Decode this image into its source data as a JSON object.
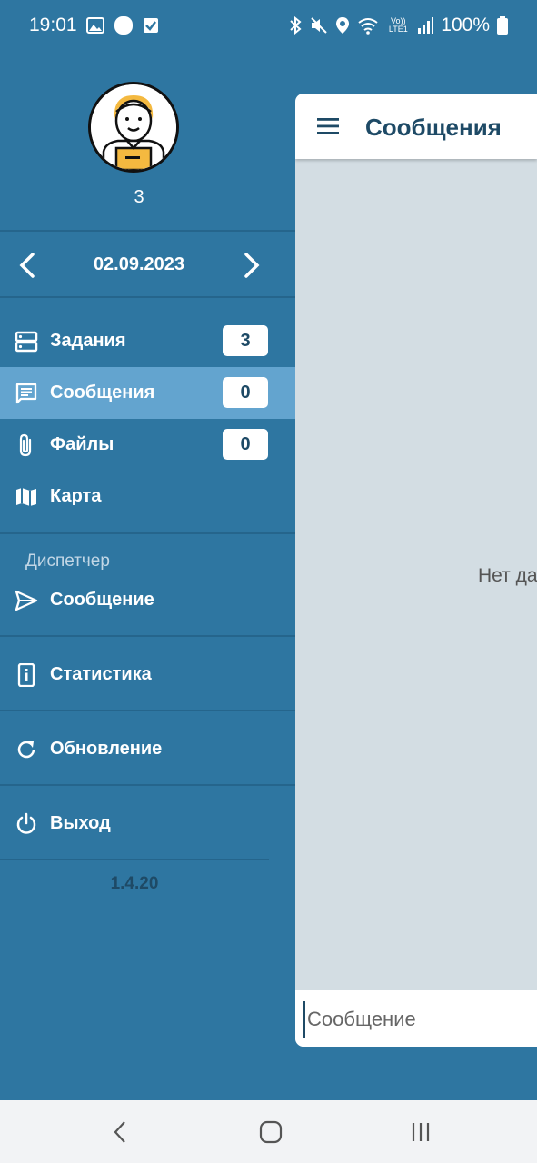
{
  "status_bar": {
    "time": "19:01",
    "battery": "100%",
    "left_icons": [
      "gallery-icon",
      "circle-notification-icon",
      "checkbox-notification-icon"
    ],
    "right_icons": [
      "bluetooth-icon",
      "mute-icon",
      "location-icon",
      "wifi-icon",
      "volte-icon",
      "signal-icon",
      "battery-icon"
    ],
    "volte_label": "Vo)) LTE1"
  },
  "drawer": {
    "user_name": "3",
    "date": "02.09.2023",
    "items": [
      {
        "label": "Задания",
        "badge": "3",
        "icon": "tasks-icon"
      },
      {
        "label": "Сообщения",
        "badge": "0",
        "icon": "messages-icon",
        "active": true
      },
      {
        "label": "Файлы",
        "badge": "0",
        "icon": "paperclip-icon"
      },
      {
        "label": "Карта",
        "icon": "map-icon"
      }
    ],
    "section_header": "Диспетчер",
    "dispatcher_items": [
      {
        "label": "Сообщение",
        "icon": "send-icon"
      }
    ],
    "extra_items": [
      {
        "label": "Статистика",
        "icon": "statistics-icon"
      },
      {
        "label": "Обновление",
        "icon": "refresh-icon"
      },
      {
        "label": "Выход",
        "icon": "power-icon"
      }
    ],
    "version": "1.4.20"
  },
  "main": {
    "title": "Сообщения",
    "empty_text": "Нет да",
    "input_placeholder": "Сообщение"
  },
  "colors": {
    "drawer_bg": "#2e76a1",
    "active_item": "#63a4cf",
    "accent_text": "#1e4a66",
    "content_bg": "#d3dde3"
  }
}
